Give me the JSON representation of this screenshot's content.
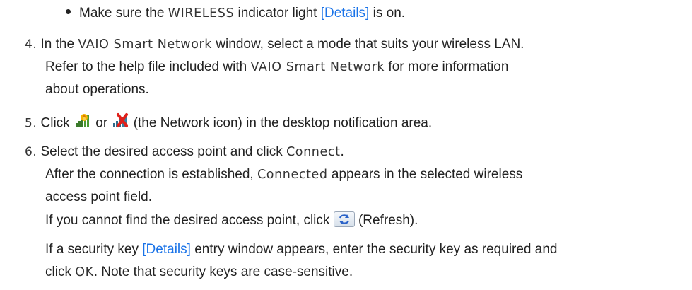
{
  "bullet1": {
    "pre": "Make sure the ",
    "term": "WIRELESS",
    "mid": " indicator light ",
    "link": "[Details]",
    "post": " is on."
  },
  "step4": {
    "num": "4.",
    "l1_pre": " In the ",
    "l1_term": "VAIO Smart Network",
    "l1_post": " window, select a mode that suits your wireless LAN.",
    "l2_pre": "Refer to the help file included with ",
    "l2_term": "VAIO Smart Network",
    "l2_post": " for more information",
    "l3": "about operations."
  },
  "step5": {
    "num": "5.",
    "pre": " Click ",
    "or": " or ",
    "post": " (the Network icon) in the desktop notification area."
  },
  "step6": {
    "num": "6.",
    "l1_pre": " Select the desired access point and click ",
    "l1_term": "Connect",
    "l1_post": ".",
    "l2_pre": "After the connection is established, ",
    "l2_term": "Connected",
    "l2_post": " appears in the selected wireless",
    "l3": "access point field.",
    "l4_pre": "If you cannot find the desired access point, click ",
    "l4_post": " (Refresh).",
    "l5_pre": "If a security key ",
    "l5_link": "[Details]",
    "l5_post": " entry window appears, enter the security key as required and",
    "l6_pre": "click ",
    "l6_term": "OK",
    "l6_post": ". Note that security keys are case-sensitive."
  },
  "icons": {
    "network_connected": "network-available-icon",
    "network_disconnected": "network-disconnected-icon",
    "refresh": "refresh-icon"
  }
}
